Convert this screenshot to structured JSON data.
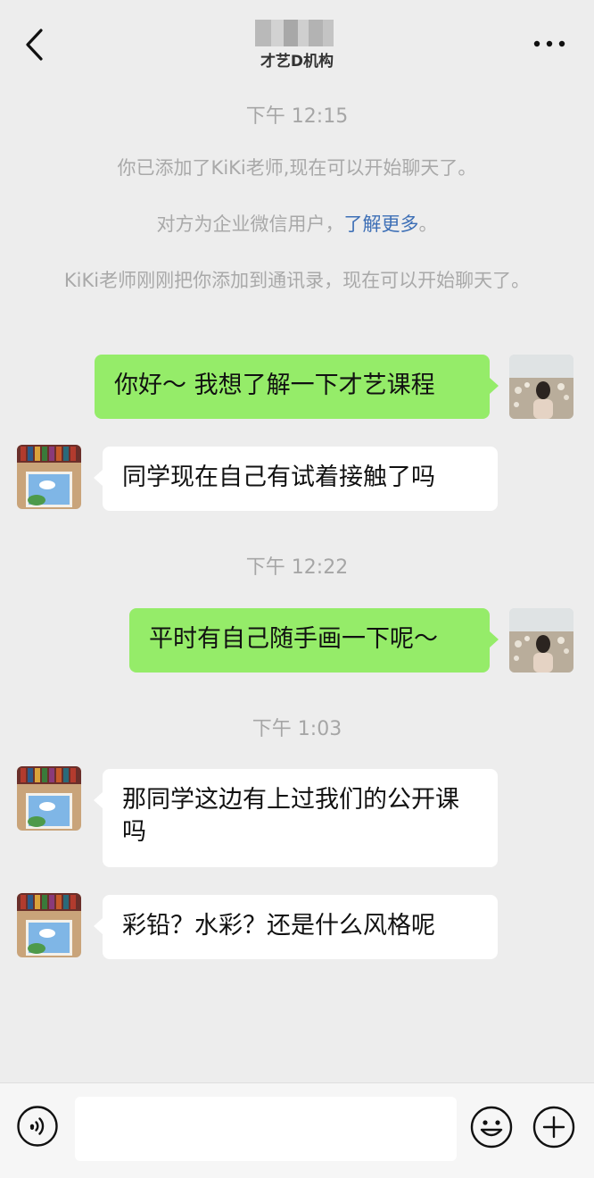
{
  "header": {
    "title": "才艺D机构",
    "back_icon": "chevron-left-icon",
    "more_icon": "more-dots-icon"
  },
  "messages": {
    "ts1": "下午 12:15",
    "sys1": "你已添加了KiKi老师,现在可以开始聊天了。",
    "sys2_prefix": "对方为企业微信用户，",
    "sys2_link": "了解更多",
    "sys2_suffix": "。",
    "sys3": "KiKi老师刚刚把你添加到通讯录，现在可以开始聊天了。",
    "msg1": "你好～ 我想了解一下才艺课程",
    "msg2": "同学现在自己有试着接触了吗",
    "ts2": "下午 12:22",
    "msg3": "平时有自己随手画一下呢～",
    "ts3": "下午 1:03",
    "msg4": "那同学这边有上过我们的公开课吗",
    "msg5": "彩铅？水彩？还是什么风格呢"
  },
  "input_bar": {
    "text_value": "",
    "voice_icon": "voice-icon",
    "emoji_icon": "emoji-icon",
    "plus_icon": "plus-icon"
  },
  "colors": {
    "background": "#ededed",
    "my_bubble": "#95ec69",
    "their_bubble": "#ffffff",
    "link": "#3d6fb6",
    "system_text": "#a9a9a9"
  }
}
